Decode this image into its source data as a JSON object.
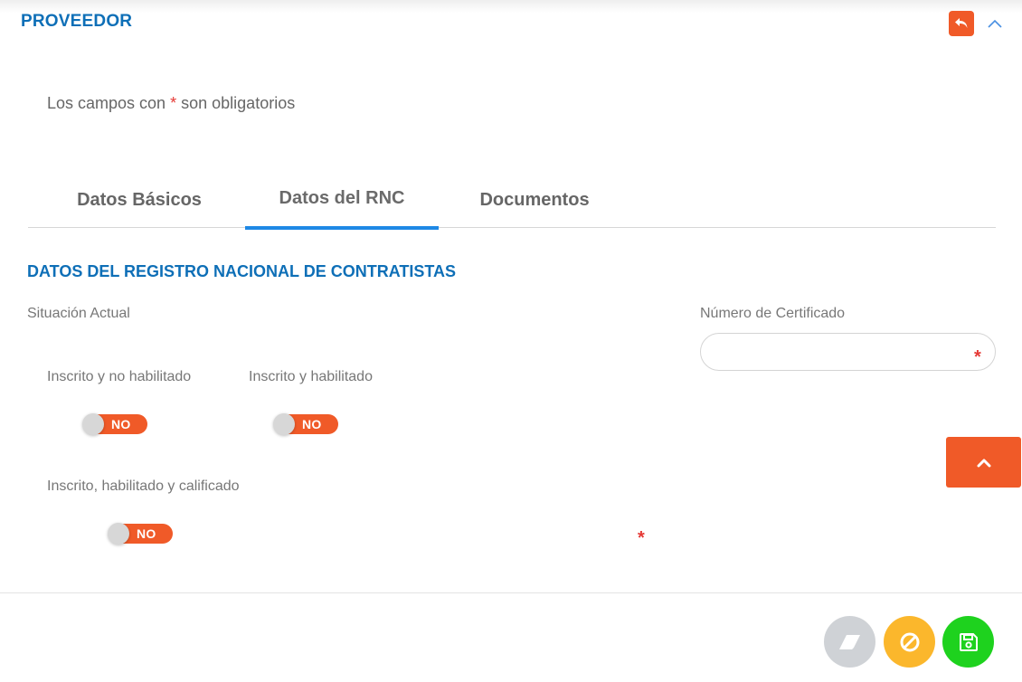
{
  "header": {
    "title": "PROVEEDOR",
    "back_icon": "undo-arrow-icon",
    "collapse_icon": "chevron-up-icon"
  },
  "required_note": {
    "prefix": "Los campos con",
    "star": "*",
    "suffix": "son obligatorios"
  },
  "tabs": [
    {
      "label": "Datos Básicos",
      "active": false
    },
    {
      "label": "Datos del RNC",
      "active": true
    },
    {
      "label": "Documentos",
      "active": false
    }
  ],
  "section": {
    "title": "DATOS DEL REGISTRO NACIONAL DE CONTRATISTAS"
  },
  "form": {
    "situacion_label": "Situación Actual",
    "certificado_label": "Número de Certificado",
    "certificado_value": "",
    "required_star": "*",
    "options": [
      {
        "label": "Inscrito y no habilitado",
        "toggle_text": "NO"
      },
      {
        "label": "Inscrito y habilitado",
        "toggle_text": "NO"
      },
      {
        "label": "Inscrito, habilitado y calificado",
        "toggle_text": "NO"
      }
    ]
  },
  "actions": {
    "scroll_top_icon": "chevron-up-icon",
    "clear_icon": "eraser-icon",
    "cancel_icon": "ban-icon",
    "save_icon": "floppy-disk-icon"
  },
  "colors": {
    "brand_blue": "#0e6fb7",
    "accent_orange": "#f05a28",
    "tab_underline": "#1e88e5",
    "required_red": "#e53935",
    "clear_gray": "#cfd2d6",
    "cancel_yellow": "#fbb72c",
    "save_green": "#1ed21e"
  }
}
